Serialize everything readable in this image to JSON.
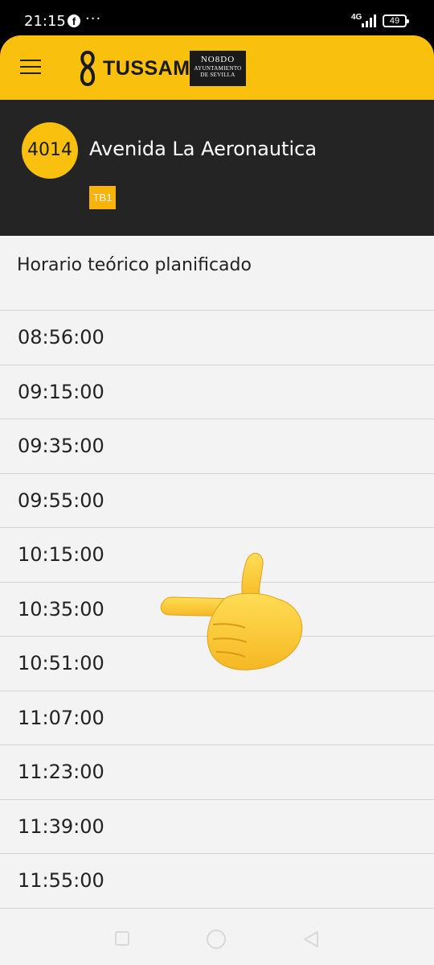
{
  "status_bar": {
    "time": "21:15",
    "facebook_glyph": "f",
    "more": "···",
    "network": "4G",
    "battery": "49"
  },
  "app_bar": {
    "brand": "TUSSAM",
    "city_mark": "NO8DO",
    "city_line1": "AYUNTAMIENTO",
    "city_line2": "DE SEVILLA",
    "color": "#f9c10e"
  },
  "stop": {
    "code": "4014",
    "name": "Avenida La Aeronautica",
    "line": "TB1"
  },
  "schedule": {
    "title": "Horario teórico planificado",
    "times": [
      "08:56:00",
      "09:15:00",
      "09:35:00",
      "09:55:00",
      "10:15:00",
      "10:35:00",
      "10:51:00",
      "11:07:00",
      "11:23:00",
      "11:39:00",
      "11:55:00"
    ]
  },
  "icons": {
    "menu": "hamburger-menu-icon",
    "recents": "square-icon",
    "home": "circle-icon",
    "back": "triangle-back-icon",
    "overlay": "pointing-left-hand-emoji"
  }
}
